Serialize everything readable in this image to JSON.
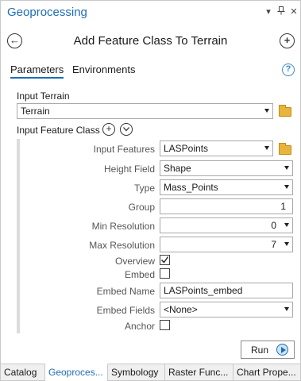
{
  "pane": {
    "title": "Geoprocessing",
    "controls": {
      "menu": "▾",
      "pin": "📌",
      "close": "✕"
    }
  },
  "tool": {
    "title": "Add Feature Class To Terrain",
    "back_symbol": "←",
    "add_symbol": "+"
  },
  "tabs": {
    "parameters": "Parameters",
    "environments": "Environments",
    "help": "?"
  },
  "params": {
    "input_terrain_label": "Input Terrain",
    "input_terrain_value": "Terrain",
    "input_feature_class_label": "Input Feature Class",
    "rows": {
      "input_features": {
        "label": "Input Features",
        "value": "LASPoints"
      },
      "height_field": {
        "label": "Height Field",
        "value": "Shape"
      },
      "type": {
        "label": "Type",
        "value": "Mass_Points"
      },
      "group": {
        "label": "Group",
        "value": "1"
      },
      "min_resolution": {
        "label": "Min Resolution",
        "value": "0"
      },
      "max_resolution": {
        "label": "Max Resolution",
        "value": "7"
      },
      "overview": {
        "label": "Overview",
        "checked": true
      },
      "embed": {
        "label": "Embed",
        "checked": false
      },
      "embed_name": {
        "label": "Embed Name",
        "value": "LASPoints_embed"
      },
      "embed_fields": {
        "label": "Embed Fields",
        "value": "<None>"
      },
      "anchor": {
        "label": "Anchor",
        "checked": false
      }
    }
  },
  "run_button": {
    "label": "Run"
  },
  "bottom_tabs": [
    {
      "label": "Catalog",
      "active": false
    },
    {
      "label": "Geoproces...",
      "active": true
    },
    {
      "label": "Symbology",
      "active": false
    },
    {
      "label": "Raster Func...",
      "active": false
    },
    {
      "label": "Chart Prope...",
      "active": false
    }
  ],
  "colors": {
    "accent": "#1f6db5",
    "folder": "#e8b53a"
  }
}
